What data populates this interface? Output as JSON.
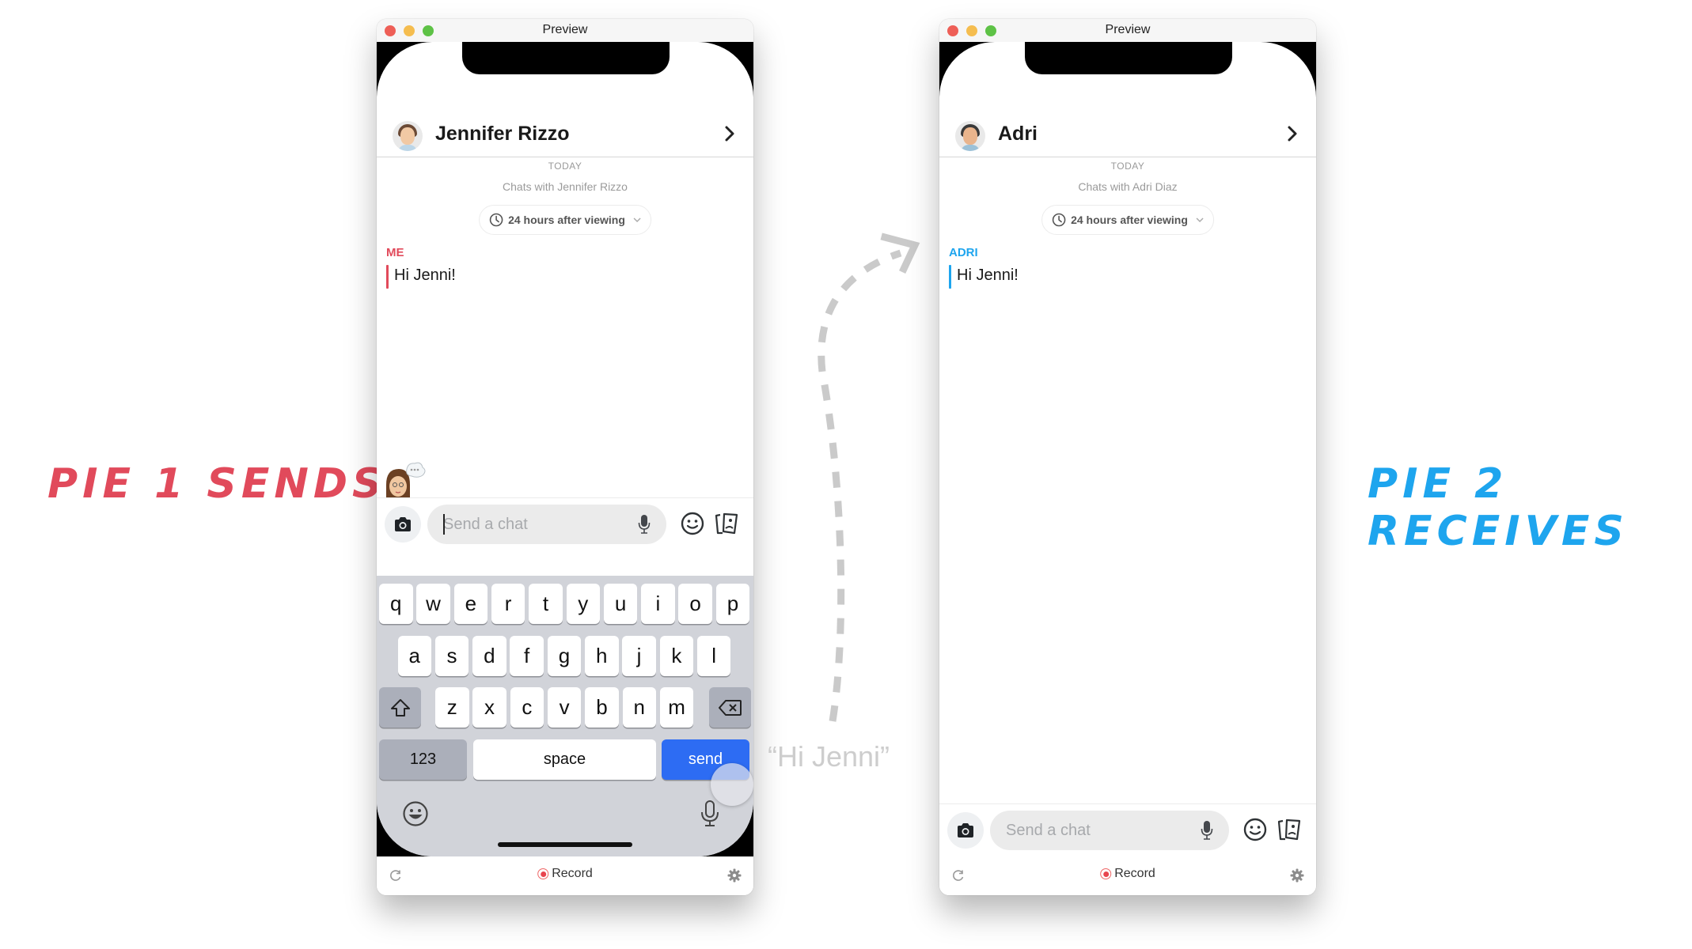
{
  "annotations": {
    "left_caption": "PIE 1 SENDS",
    "right_caption": "PIE 2 RECEIVES",
    "transit_caption": "“Hi Jenni”",
    "left_color": "#e14a5b",
    "right_color": "#1ea5ee"
  },
  "sender_window": {
    "title": "Preview",
    "contact_name": "Jennifer Rizzo",
    "day_label": "TODAY",
    "chats_with": "Chats with Jennifer Rizzo",
    "retention": "24 hours after viewing",
    "messages": [
      {
        "sender": "ME",
        "text": "Hi Jenni!",
        "color": "#e14a5b"
      }
    ],
    "input_placeholder": "Send a chat",
    "typing_indicator": "...",
    "keyboard": {
      "row1": [
        "q",
        "w",
        "e",
        "r",
        "t",
        "y",
        "u",
        "i",
        "o",
        "p"
      ],
      "row2": [
        "a",
        "s",
        "d",
        "f",
        "g",
        "h",
        "j",
        "k",
        "l"
      ],
      "row3": [
        "z",
        "x",
        "c",
        "v",
        "b",
        "n",
        "m"
      ],
      "numbers_label": "123",
      "space_label": "space",
      "send_label": "send"
    },
    "record_label": "Record"
  },
  "receiver_window": {
    "title": "Preview",
    "contact_name": "Adri",
    "day_label": "TODAY",
    "chats_with": "Chats with Adri Diaz",
    "retention": "24 hours after viewing",
    "messages": [
      {
        "sender": "ADRI",
        "text": "Hi Jenni!",
        "color": "#1ea5ee"
      }
    ],
    "input_placeholder": "Send a chat",
    "record_label": "Record"
  }
}
